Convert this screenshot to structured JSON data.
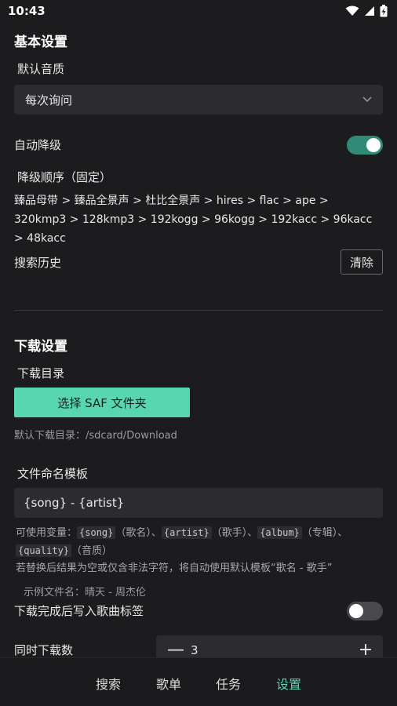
{
  "status_bar": {
    "time": "10:43"
  },
  "basic": {
    "title": "基本设置",
    "quality_label": "默认音质",
    "quality_value": "每次询问",
    "auto_downgrade_label": "自动降级",
    "auto_downgrade_on": true,
    "order_title": "降级顺序（固定）",
    "order_text": "臻品母带 > 臻品全景声 > 杜比全景声 > hires > flac > ape > 320kmp3 > 128kmp3 > 192kogg > 96kogg > 192kacc > 96kacc > 48kacc",
    "history_label": "搜索历史",
    "clear_label": "清除"
  },
  "download": {
    "title": "下载设置",
    "dir_label": "下载目录",
    "saf_button": "选择 SAF 文件夹",
    "default_dir": "默认下载目录：/sdcard/Download",
    "naming_label": "文件命名模板",
    "naming_value": "{song} - {artist}",
    "help": {
      "prefix": "可使用变量：",
      "var_song": "{song}",
      "song_desc": "（歌名）、",
      "var_artist": "{artist}",
      "artist_desc": "（歌手）、",
      "var_album": "{album}",
      "album_desc": "（专辑）、",
      "var_quality": "{quality}",
      "quality_desc": "（音质）",
      "fallback": "若替换后结果为空或仅含非法字符，将自动使用默认模板“歌名 - 歌手”"
    },
    "example": "示例文件名：晴天 - 周杰伦",
    "write_tags_label": "下载完成后写入歌曲标签",
    "write_tags_on": false,
    "concurrent_label": "同时下载数",
    "concurrent_value": "3",
    "minus": "—",
    "plus": "+"
  },
  "nav": {
    "items": [
      "搜索",
      "歌单",
      "任务",
      "设置"
    ],
    "active_index": 3,
    "active_color": "#5ad6b1"
  },
  "colors": {
    "accent": "#57d6b0",
    "toggle_on": "#2f8b76",
    "background": "#1c1c1f"
  }
}
